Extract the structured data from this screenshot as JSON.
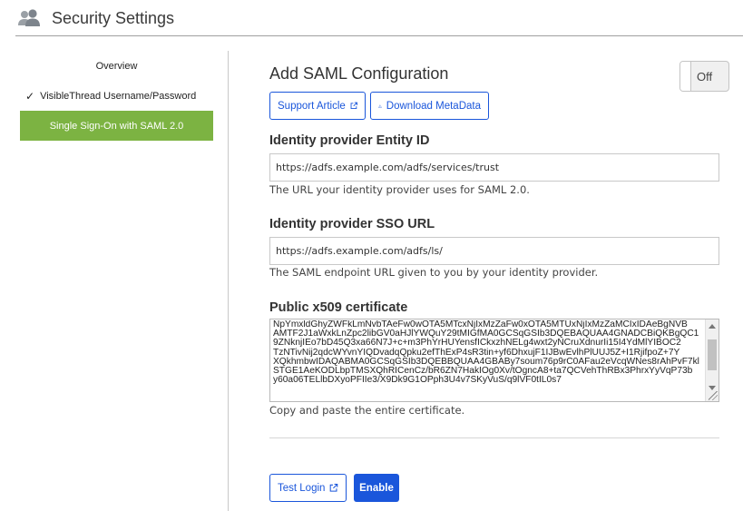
{
  "header": {
    "title": "Security Settings",
    "icon": "users-icon"
  },
  "sidebar": {
    "items": [
      {
        "label": "Overview",
        "checked": false,
        "active": false
      },
      {
        "label": "VisibleThread Username/Password",
        "checked": true,
        "active": false
      },
      {
        "label": "Single Sign-On with SAML 2.0",
        "checked": false,
        "active": true
      }
    ],
    "active_color": "#7cb342"
  },
  "main": {
    "title": "Add SAML Configuration",
    "toggle": {
      "label": "Off",
      "state": "off"
    },
    "buttons": {
      "support_article": "Support Article",
      "download_metadata": "Download MetaData",
      "test_login": "Test Login",
      "enable": "Enable"
    },
    "entity_id": {
      "label": "Identity provider Entity ID",
      "value": "https://adfs.example.com/adfs/services/trust",
      "help": "The URL your identity provider uses for SAML 2.0."
    },
    "sso_url": {
      "label": "Identity provider SSO URL",
      "value": "https://adfs.example.com/adfs/ls/",
      "help": "The SAML endpoint URL given to you by your identity provider."
    },
    "certificate": {
      "label": "Public x509 certificate",
      "value": "NpYmxldGhyZWFkLmNvbTAeFw0wOTA5MTcxNjIxMzZaFw0xOTA5MTUxNjIxMzZaMCIxIDAeBgNVB\nAMTF2J1aWxkLnZpc2libGV0aHJlYWQuY29tMIGfMA0GCSqGSIb3DQEBAQUAA4GNADCBiQKBgQC1\n9ZNknjIEo7bD45Q3xa66N7J+c+m3PhYrHUYensfICkxzhNELg4wxt2yNCruXdnurIi15I4YdMlYIBOC2\nTzNTivNij2qdcWYvnYIQDvadqQpku2efThExP4sR3tin+yf6DhxujF1IJBwEvlhPlUUJ5Z+I1RjifpoZ+7Y\nXQkhmbwIDAQABMA0GCSqGSIb3DQEBBQUAA4GBABy7soum76p9rC0AFau2eVcqWNes8rAhPvF7kl\nSTGE1AeKODLbpTMSXQhRICenCz/bR6ZN7HakIOg0Xv/tOgncA8+ta7QCVehThRBx3PhrxYyVqP73b\ny60a06TELlbDXyoPFIIe3/X9Dk9G1OPph3U4v7SKyVuS/q9lVF0tIL0s7",
      "help": "Copy and paste the entire certificate."
    }
  },
  "colors": {
    "primary": "#1a56db",
    "accent": "#7cb342"
  }
}
